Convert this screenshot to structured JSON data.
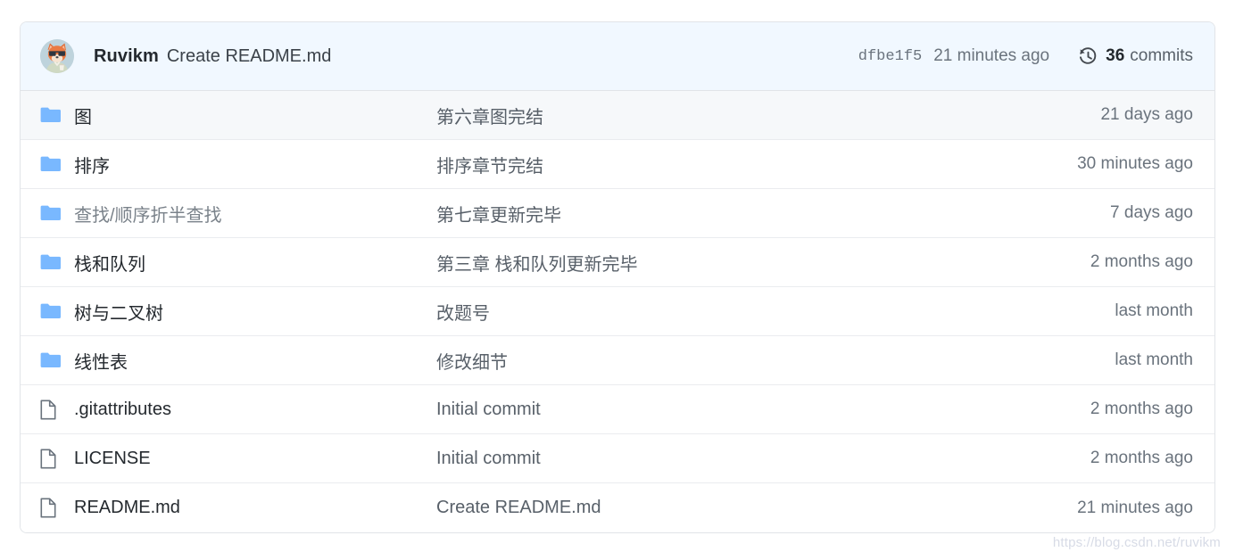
{
  "header": {
    "avatar_name": "user-avatar",
    "author": "Ruvikm",
    "latest_commit_message": "Create README.md",
    "sha": "dfbe1f5",
    "time": "21 minutes ago",
    "history_icon": "history-icon",
    "commits_count": "36",
    "commits_label": "commits",
    "background_color": "#f1f8ff"
  },
  "colors": {
    "folder_icon": "#79b8ff",
    "file_icon": "#6a737d",
    "border": "#e1e4e8",
    "row_divider": "#eaecef",
    "shaded_row": "#f6f8fa",
    "link_text": "#24292e",
    "muted_text": "#6a737d"
  },
  "rows": [
    {
      "icon": "folder-icon",
      "type": "folder",
      "name": "图",
      "message": "第六章图完结",
      "time": "21 days ago",
      "shaded": true,
      "muted": false
    },
    {
      "icon": "folder-icon",
      "type": "folder",
      "name": "排序",
      "message": "排序章节完结",
      "time": "30 minutes ago",
      "shaded": false,
      "muted": false
    },
    {
      "icon": "folder-icon",
      "type": "folder",
      "name": "查找/顺序折半查找",
      "message": "第七章更新完毕",
      "time": "7 days ago",
      "shaded": false,
      "muted": true
    },
    {
      "icon": "folder-icon",
      "type": "folder",
      "name": "栈和队列",
      "message": "第三章 栈和队列更新完毕",
      "time": "2 months ago",
      "shaded": false,
      "muted": false
    },
    {
      "icon": "folder-icon",
      "type": "folder",
      "name": "树与二叉树",
      "message": "改题号",
      "time": "last month",
      "shaded": false,
      "muted": false
    },
    {
      "icon": "folder-icon",
      "type": "folder",
      "name": "线性表",
      "message": "修改细节",
      "time": "last month",
      "shaded": false,
      "muted": false
    },
    {
      "icon": "file-icon",
      "type": "file",
      "name": ".gitattributes",
      "message": "Initial commit",
      "time": "2 months ago",
      "shaded": false,
      "muted": false
    },
    {
      "icon": "file-icon",
      "type": "file",
      "name": "LICENSE",
      "message": "Initial commit",
      "time": "2 months ago",
      "shaded": false,
      "muted": false
    },
    {
      "icon": "file-icon",
      "type": "file",
      "name": "README.md",
      "message": "Create README.md",
      "time": "21 minutes ago",
      "shaded": false,
      "muted": false
    }
  ],
  "watermark": "https://blog.csdn.net/ruvikm"
}
